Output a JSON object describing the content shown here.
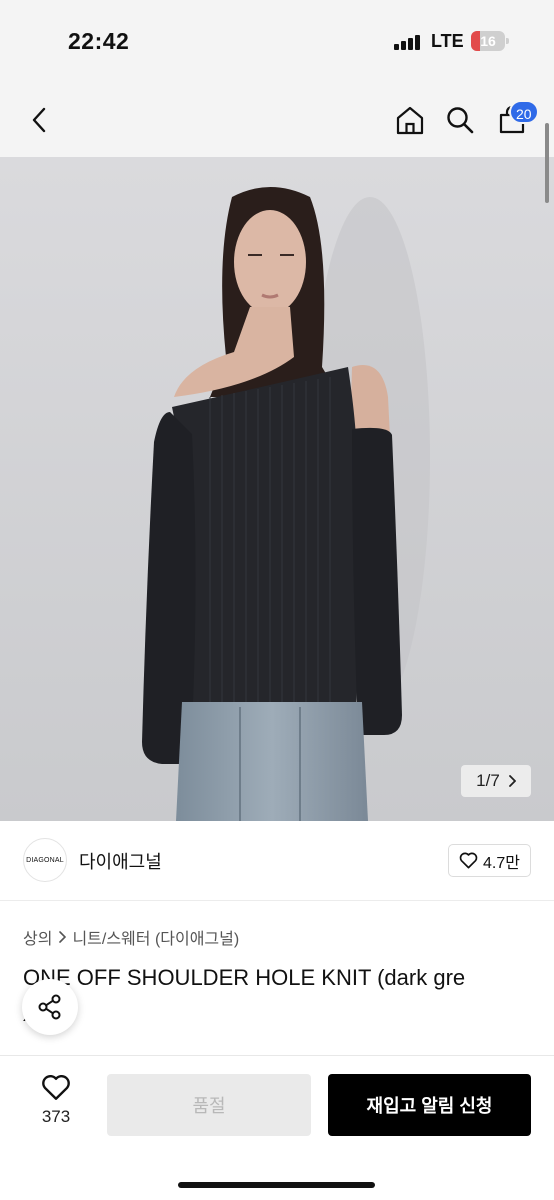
{
  "status_bar": {
    "time": "22:42",
    "network": "LTE",
    "battery": "16"
  },
  "nav": {
    "back_icon": "chevron-left-icon",
    "home_icon": "home-icon",
    "search_icon": "search-icon",
    "cart_icon": "shopping-bag-icon",
    "cart_count": "20"
  },
  "gallery": {
    "current": "1",
    "separator": "/",
    "total": "7"
  },
  "brand": {
    "logo_text": "DIAGONAL",
    "name": "다이애그널",
    "likes": "4.7만"
  },
  "breadcrumb": {
    "level1": "상의",
    "level2": "니트/스웨터 (다이애그널)"
  },
  "product": {
    "title": "ONE OFF SHOULDER HOLE KNIT (dark gre",
    "title_cont": ")"
  },
  "bottom_bar": {
    "wish_count": "373",
    "soldout_label": "품절",
    "restock_label": "재입고 알림 신청"
  },
  "colors": {
    "accent_badge": "#2f6ae8",
    "primary_button": "#000000",
    "disabled_button": "#eaeaea"
  }
}
